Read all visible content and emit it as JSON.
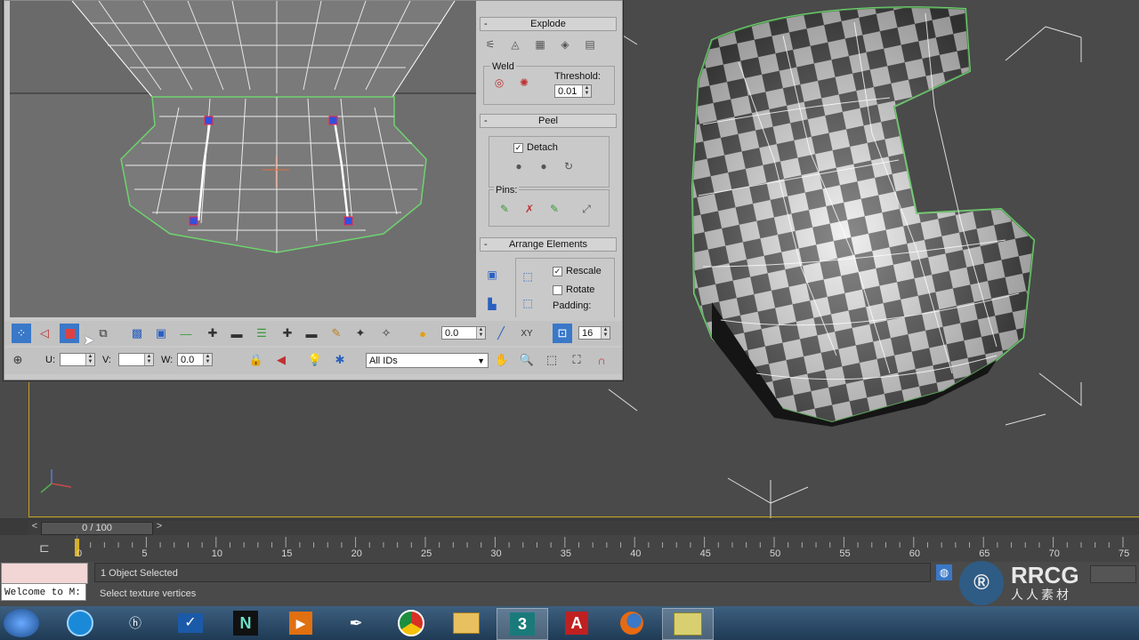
{
  "uv_editor": {
    "explode": {
      "title": "Explode"
    },
    "weld": {
      "label": "Weld",
      "threshold_label": "Threshold:",
      "threshold_value": "0.01"
    },
    "peel": {
      "title": "Peel",
      "detach_label": "Detach",
      "detach_checked": true,
      "pins_label": "Pins:"
    },
    "arrange": {
      "title": "Arrange Elements",
      "rescale_label": "Rescale",
      "rescale_checked": true,
      "rotate_label": "Rotate",
      "rotate_checked": false,
      "padding_label": "Padding:"
    },
    "toolbar": {
      "spinner_value": "0.0",
      "axis_label": "XY",
      "grid_value": "16",
      "u_label": "U:",
      "u_value": "",
      "v_label": "V:",
      "v_value": "",
      "w_label": "W:",
      "w_value": "0.0",
      "id_filter": "All IDs"
    }
  },
  "timeline": {
    "frame_display": "0 / 100",
    "prev_arrow": "<",
    "next_arrow": ">",
    "ticks": [
      "0",
      "5",
      "10",
      "15",
      "20",
      "25",
      "30",
      "35",
      "40",
      "45",
      "50",
      "55",
      "60",
      "65",
      "70",
      "75"
    ]
  },
  "status": {
    "maxscript_text": "Welcome to M:",
    "selection_text": "1 Object Selected",
    "prompt_text": "Select texture vertices"
  },
  "watermark": {
    "brand": "RRCG",
    "sub": "人人素材"
  },
  "taskbar": {
    "apps": [
      "start-orb",
      "media-center-icon",
      "hp-icon",
      "checkmark-app-icon",
      "n-app-icon",
      "media-player-icon",
      "inkscape-icon",
      "chrome-icon",
      "file-explorer-icon",
      "3dsmax-icon",
      "autodesk-a-icon",
      "firefox-icon",
      "notes-icon"
    ]
  },
  "colors": {
    "accent_blue": "#3a78c8",
    "seam_green": "#4ecb4e",
    "viewport_bg": "#4a4a4a",
    "panel_bg": "#c9c9c9"
  }
}
